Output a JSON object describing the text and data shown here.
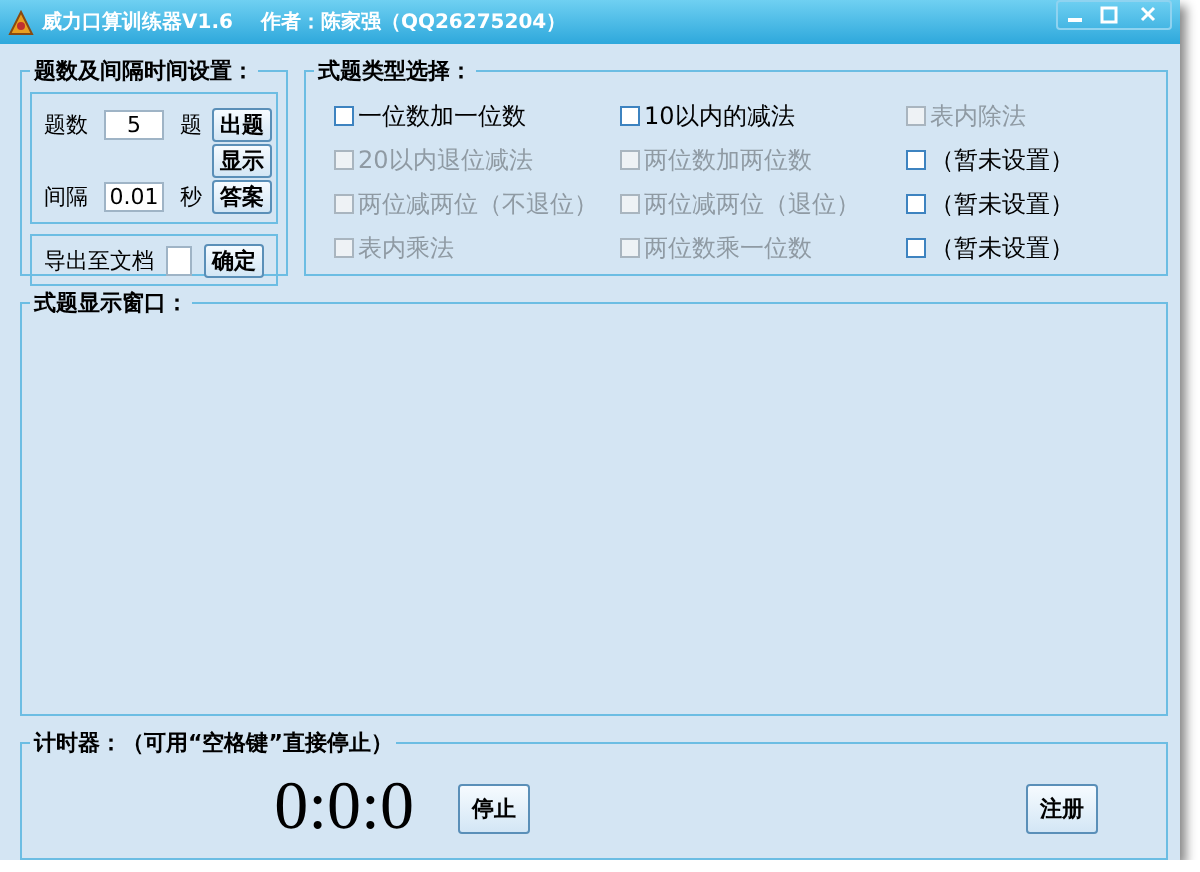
{
  "window": {
    "title": "威力口算训练器V1.6",
    "author": "作者：陈家强（QQ26275204）"
  },
  "settings": {
    "title": "题数及间隔时间设置：",
    "count_label": "题数",
    "count_value": "5",
    "count_unit": "题",
    "interval_label": "间隔",
    "interval_value": "0.01",
    "interval_unit": "秒",
    "buttons": [
      "出题",
      "显示",
      "答案"
    ],
    "export_label": "导出至文档",
    "export_button": "确定"
  },
  "types": {
    "title": "式题类型选择：",
    "options": [
      {
        "label": "一位数加一位数",
        "checked": false,
        "disabled": false
      },
      {
        "label": "10以内的减法",
        "checked": false,
        "disabled": false
      },
      {
        "label": "表内除法",
        "checked": false,
        "disabled": true
      },
      {
        "label": "20以内退位减法",
        "checked": false,
        "disabled": true
      },
      {
        "label": "两位数加两位数",
        "checked": false,
        "disabled": true
      },
      {
        "label": "（暂未设置）",
        "checked": false,
        "disabled": false
      },
      {
        "label": "两位减两位（不退位）",
        "checked": false,
        "disabled": true
      },
      {
        "label": "两位减两位（退位）",
        "checked": false,
        "disabled": true
      },
      {
        "label": "（暂未设置）",
        "checked": false,
        "disabled": false
      },
      {
        "label": "表内乘法",
        "checked": false,
        "disabled": true
      },
      {
        "label": "两位数乘一位数",
        "checked": false,
        "disabled": true
      },
      {
        "label": "（暂未设置）",
        "checked": false,
        "disabled": false
      }
    ]
  },
  "display": {
    "title": "式题显示窗口："
  },
  "timer": {
    "title": "计时器：（可用“空格键”直接停止）",
    "clock": "0:0:0",
    "stop_button": "停止",
    "register_button": "注册"
  }
}
